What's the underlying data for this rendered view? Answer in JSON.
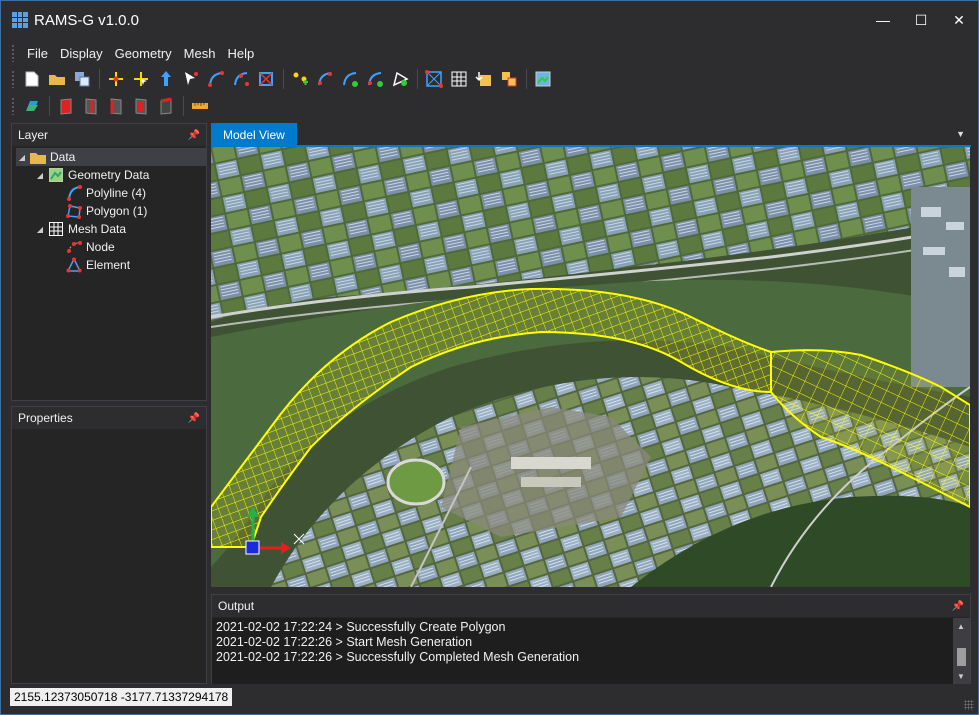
{
  "window": {
    "title": "RAMS-G v1.0.0",
    "minimize": "—",
    "maximize": "☐",
    "close": "✕"
  },
  "menu": [
    "File",
    "Display",
    "Geometry",
    "Mesh",
    "Help"
  ],
  "toolbar1": [
    "new-file-icon",
    "open-folder-icon",
    "save-icon",
    "add-point-icon",
    "select-point-icon",
    "move-point-icon",
    "delete-point-icon",
    "add-polyline-icon",
    "edit-polyline-icon",
    "split-polyline-icon",
    "node-add-icon",
    "polyline-node-icon",
    "polyline-move-icon",
    "polyline-add-icon",
    "polygon-edit-icon",
    "mesh-generate-icon",
    "mesh-grid-icon",
    "mesh-import-icon",
    "mesh-export-icon",
    "map-view-icon"
  ],
  "toolbar2": [
    "layer-refresh-icon",
    "box-front-icon",
    "box-right-icon",
    "box-left-icon",
    "box-back-icon",
    "box-top-icon",
    "ruler-icon"
  ],
  "layer_panel": {
    "title": "Layer",
    "tree": [
      {
        "label": "Data",
        "indent": 0,
        "icon": "folder-icon",
        "expanded": true,
        "selected": true
      },
      {
        "label": "Geometry Data",
        "indent": 1,
        "icon": "geometry-data-icon",
        "expanded": true
      },
      {
        "label": "Polyline (4)",
        "indent": 2,
        "icon": "polyline-icon"
      },
      {
        "label": "Polygon (1)",
        "indent": 2,
        "icon": "polygon-icon"
      },
      {
        "label": "Mesh Data",
        "indent": 1,
        "icon": "mesh-data-icon",
        "expanded": true
      },
      {
        "label": "Node",
        "indent": 2,
        "icon": "node-icon"
      },
      {
        "label": "Element",
        "indent": 2,
        "icon": "element-icon"
      }
    ]
  },
  "properties_panel": {
    "title": "Properties"
  },
  "model_view": {
    "tab_label": "Model View",
    "mesh_color": "#ffff00"
  },
  "output_panel": {
    "title": "Output",
    "lines": [
      "2021-02-02 17:22:24 > Successfully Create Polygon",
      "2021-02-02 17:22:26 > Start Mesh Generation",
      "2021-02-02 17:22:26 > Successfully Completed Mesh Generation"
    ]
  },
  "status": {
    "coordinates": "2155.12373050718 -3177.71337294178"
  },
  "colors": {
    "accent": "#007acc",
    "background": "#2d2d30",
    "panel": "#252526"
  }
}
